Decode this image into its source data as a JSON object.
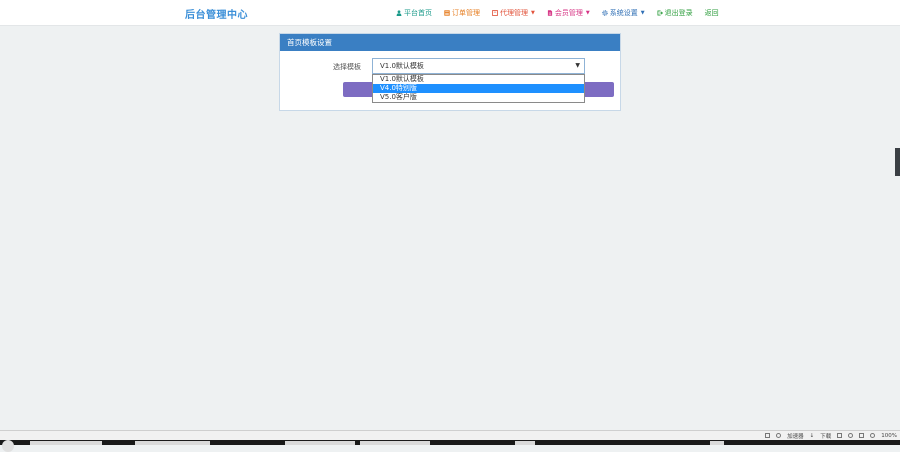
{
  "header": {
    "brand": "后台管理中心",
    "nav": [
      {
        "label": "平台首页",
        "icon": "user-icon",
        "color": "#1a9a8a",
        "has_caret": false
      },
      {
        "label": "订单管理",
        "icon": "list-icon",
        "color": "#e67e22",
        "has_caret": false
      },
      {
        "label": "代理管理",
        "icon": "book-icon",
        "color": "#e2543c",
        "has_caret": true
      },
      {
        "label": "会员管理",
        "icon": "doc-icon",
        "color": "#d63384",
        "has_caret": true
      },
      {
        "label": "系统设置",
        "icon": "gear-icon",
        "color": "#2f6fb5",
        "has_caret": true
      },
      {
        "label": "退出登录",
        "icon": "exit-icon",
        "color": "#2e9e3e",
        "has_caret": false
      },
      {
        "label": "返回",
        "icon": "",
        "color": "#2e9e3e",
        "has_caret": false
      }
    ]
  },
  "panel": {
    "title": "首页模板设置",
    "field_label": "选择模板",
    "select_value": "V1.0默认模板",
    "options": [
      "V1.0默认模板",
      "V4.0特别版",
      "V5.0客户版"
    ],
    "highlighted_index": 1,
    "header_color": "#3a7fc3",
    "button_color": "#7d6cc2"
  },
  "statusbar": {
    "accelerator": "加速器",
    "download": "下载",
    "zoom": "100%"
  }
}
